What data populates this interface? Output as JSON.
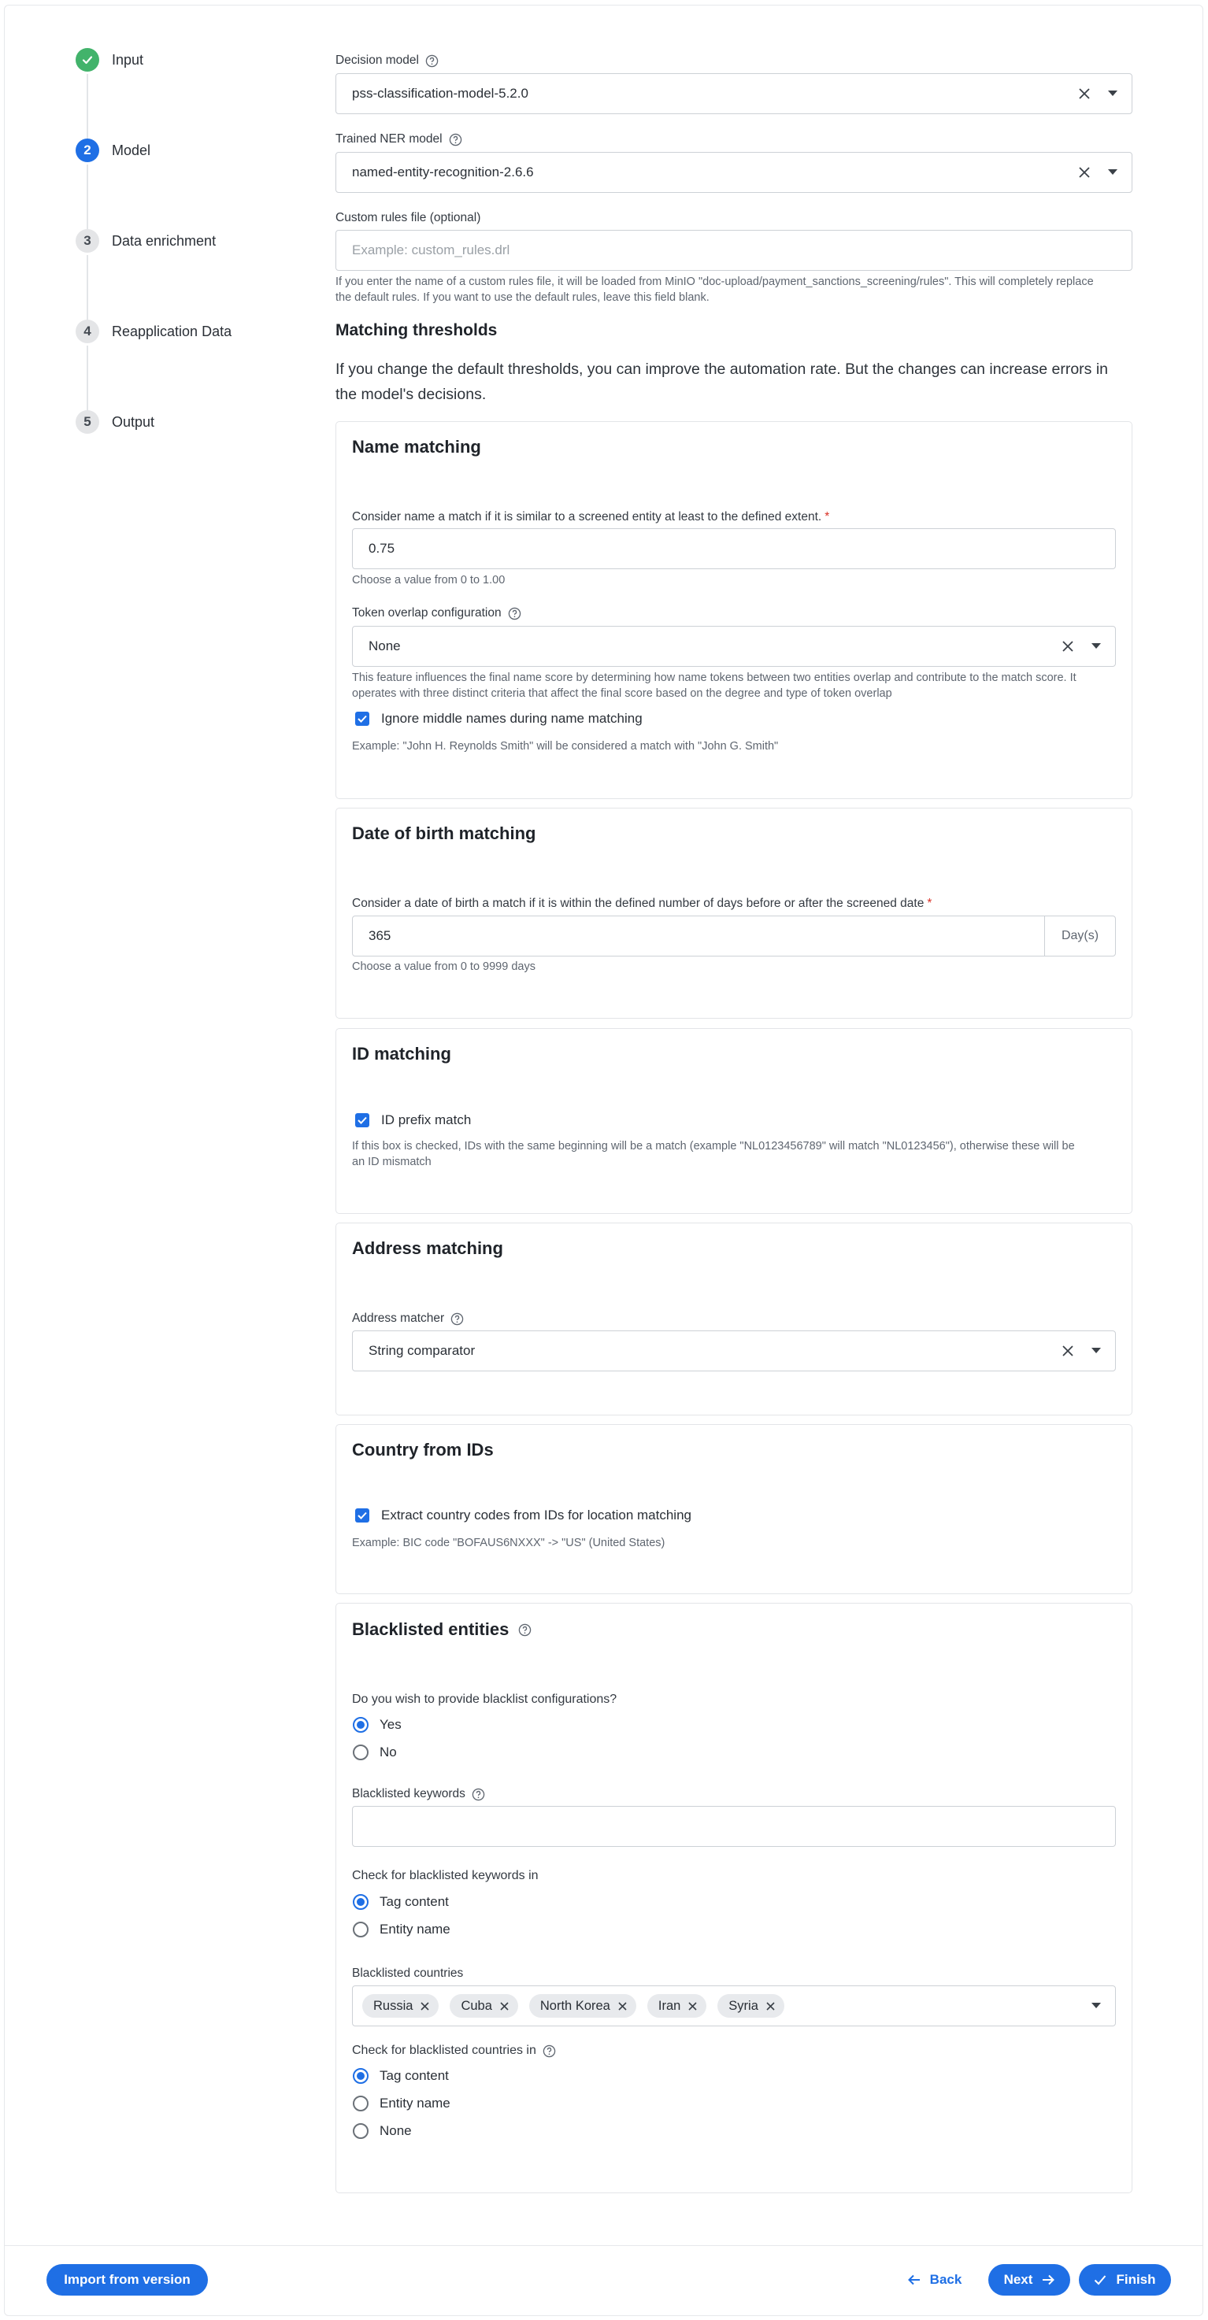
{
  "stepper": {
    "steps": [
      {
        "number": "",
        "label": "Input",
        "state": "done"
      },
      {
        "number": "2",
        "label": "Model",
        "state": "active"
      },
      {
        "number": "3",
        "label": "Data enrichment",
        "state": "pending"
      },
      {
        "number": "4",
        "label": "Reapplication Data",
        "state": "pending"
      },
      {
        "number": "5",
        "label": "Output",
        "state": "pending"
      }
    ]
  },
  "form": {
    "decision_model": {
      "label": "Decision model",
      "value": "pss-classification-model-5.2.0"
    },
    "ner_model": {
      "label": "Trained NER model",
      "value": "named-entity-recognition-2.6.6"
    },
    "custom_rules": {
      "label": "Custom rules file (optional)",
      "placeholder": "Example: custom_rules.drl",
      "hint_line1": "If you enter the name of a custom rules file, it will be loaded from MinIO \"doc-upload/payment_sanctions_screening/rules\". This will completely replace",
      "hint_line2": "the default rules. If you want to use the default rules, leave this field blank."
    },
    "thresholds": {
      "title": "Matching thresholds",
      "description_line1": "If you change the default thresholds, you can improve the automation rate. But the changes can increase errors in",
      "description_line2": "the model's decisions."
    },
    "name_matching": {
      "title": "Name matching",
      "threshold_label": "Consider name a match if it is similar to a screened entity at least to the defined extent.",
      "threshold_value": "0.75",
      "threshold_hint": "Choose a value from 0 to 1.00",
      "token_label": "Token overlap configuration",
      "token_value": "None",
      "token_hint_line1": "This feature influences the final name score by determining how name tokens between two entities overlap and contribute to the match score. It",
      "token_hint_line2": "operates with three distinct criteria that affect the final score based on the degree and type of token overlap",
      "ignore_middle_label": "Ignore middle names during name matching",
      "ignore_middle_checked": true,
      "ignore_middle_hint": "Example: \"John H. Reynolds Smith\" will be considered a match with \"John G. Smith\""
    },
    "dob_matching": {
      "title": "Date of birth matching",
      "label": "Consider a date of birth a match if it is within the defined number of days before or after the screened date",
      "value": "365",
      "suffix": "Day(s)",
      "hint": "Choose a value from 0 to 9999 days"
    },
    "id_matching": {
      "title": "ID matching",
      "prefix_label": "ID prefix match",
      "prefix_checked": true,
      "hint_line1": "If this box is checked, IDs with the same beginning will be a match (example \"NL0123456789\" will match \"NL0123456\"), otherwise these will be",
      "hint_line2": "an ID mismatch"
    },
    "address_matching": {
      "title": "Address matching",
      "label": "Address matcher",
      "value": "String comparator"
    },
    "country_from_ids": {
      "title": "Country from IDs",
      "label": "Extract country codes from IDs for location matching",
      "checked": true,
      "hint": "Example: BIC code \"BOFAUS6NXXX\" -> \"US\" (United States)"
    },
    "blacklist": {
      "title": "Blacklisted entities",
      "question": "Do you wish to provide blacklist configurations?",
      "options": [
        "Yes",
        "No"
      ],
      "selected": "Yes",
      "keywords_label": "Blacklisted keywords",
      "keywords_value": "",
      "check_keywords_label": "Check for blacklisted keywords in",
      "check_keywords_options": [
        "Tag content",
        "Entity name"
      ],
      "check_keywords_selected": "Tag content",
      "countries_label": "Blacklisted countries",
      "countries": [
        "Russia",
        "Cuba",
        "North Korea",
        "Iran",
        "Syria"
      ],
      "check_countries_label": "Check for blacklisted countries in",
      "check_countries_options": [
        "Tag content",
        "Entity name",
        "None"
      ],
      "check_countries_selected": "Tag content"
    }
  },
  "footer": {
    "import_label": "Import from version",
    "back_label": "Back",
    "next_label": "Next",
    "finish_label": "Finish"
  },
  "colors": {
    "primary": "#1f6fe5",
    "success": "#42b36b"
  }
}
